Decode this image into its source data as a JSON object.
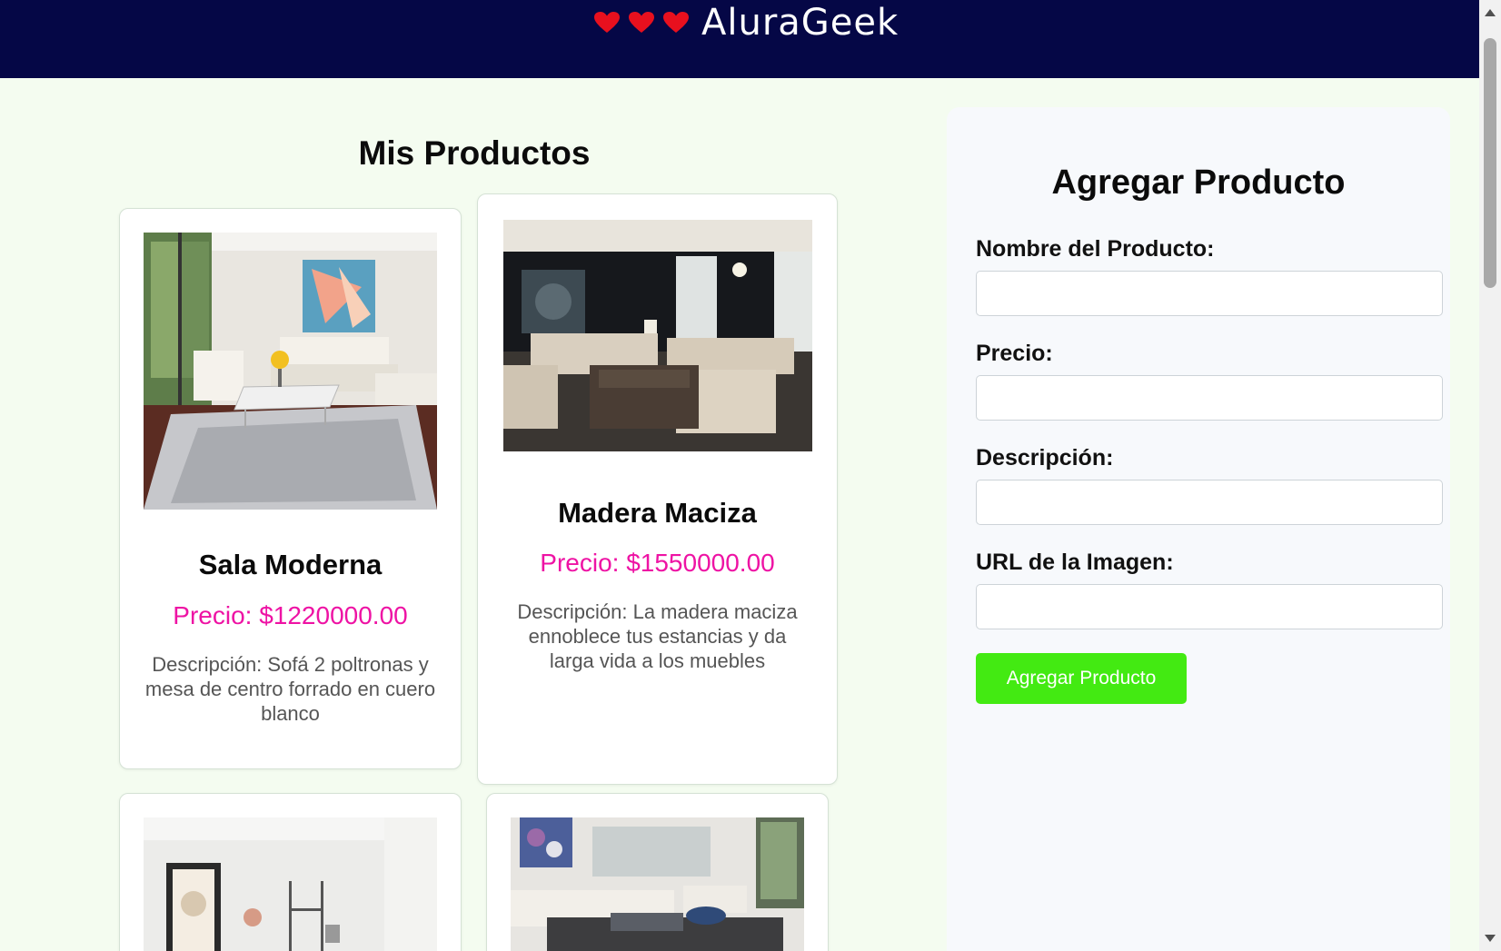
{
  "header": {
    "brand_name": "AluraGeek",
    "hearts_color": "#e8101e",
    "background": "#050746"
  },
  "products_section": {
    "title": "Mis Productos"
  },
  "products": [
    {
      "name": "Sala Moderna",
      "price": "Precio: $1220000.00",
      "description": "Descripción: Sofá 2 poltronas y mesa de centro forrado en cuero blanco"
    },
    {
      "name": "Madera Maciza",
      "price": "Precio: $1550000.00",
      "description": "Descripción: La madera maciza ennoblece tus estancias y da larga vida a los muebles"
    },
    {
      "name": "",
      "price": "",
      "description": ""
    },
    {
      "name": "",
      "price": "",
      "description": ""
    }
  ],
  "form": {
    "title": "Agregar Producto",
    "name_label": "Nombre del Producto:",
    "price_label": "Precio:",
    "description_label": "Descripción:",
    "image_url_label": "URL de la Imagen:",
    "name_value": "",
    "price_value": "",
    "description_value": "",
    "image_url_value": "",
    "submit_label": "Agregar Producto"
  },
  "colors": {
    "page_background": "#f4fcf0",
    "price_text": "#ee13a4",
    "submit_button": "#43ea12"
  }
}
